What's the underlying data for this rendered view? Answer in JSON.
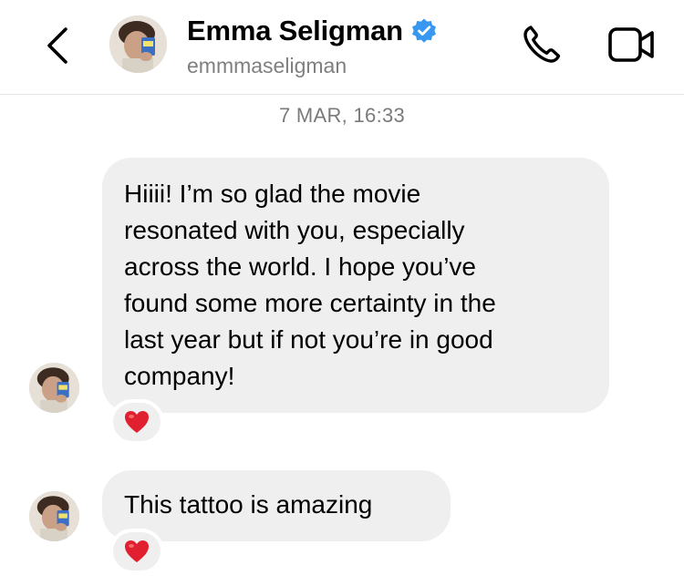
{
  "header": {
    "name": "Emma Seligman",
    "username": "emmmaseligman",
    "verified": true,
    "icons": [
      "chevron-left-icon",
      "verified-badge-icon",
      "phone-icon",
      "video-camera-icon"
    ]
  },
  "timestamp": "7 MAR, 16:33",
  "messages": [
    {
      "lines": [
        "Hiiii! I’m so glad the movie",
        "resonated with you, especially",
        "across the world. I hope you’ve",
        "found some more certainty in the",
        "last year but if not you’re in good",
        "company!"
      ],
      "reaction": "❤️"
    },
    {
      "lines": [
        "This tattoo is amazing"
      ],
      "reaction": "❤️"
    }
  ],
  "colors": {
    "bubble": "#efefef",
    "verified": "#3897f0",
    "muted_text": "#7a7a7a",
    "divider": "#e3e3e3",
    "heart": "#e0202e"
  }
}
